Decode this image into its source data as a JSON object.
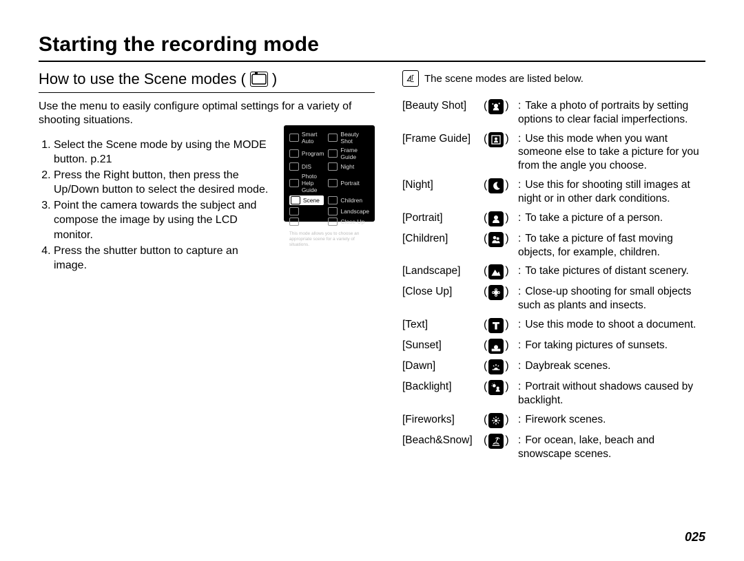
{
  "title": "Starting the recording mode",
  "page_number": "025",
  "left": {
    "subheading": "How to use the Scene modes (",
    "subheading_close": ")",
    "subheading_icon": "scene-mode-icon",
    "intro": "Use the menu to easily configure optimal settings for a variety of shooting situations.",
    "steps": [
      "Select the Scene mode by using the MODE button. p.21",
      "Press the Right button, then press the Up/Down button to select the desired mode.",
      "Point the camera towards the subject and compose the image by using the LCD monitor.",
      "Press the shutter button to capture an image."
    ],
    "lcd_menu_left": [
      "Smart Auto",
      "Program",
      "DIS",
      "Photo Help Guide",
      "Scene"
    ],
    "lcd_menu_right": [
      "Beauty Shot",
      "Frame Guide",
      "Night",
      "Portrait",
      "Children",
      "Landscape",
      "Close Up"
    ],
    "lcd_highlight": "Scene",
    "lcd_desc": "This mode allows you to choose an appropriate scene for a variety of situations."
  },
  "right": {
    "note": "The scene modes are listed below.",
    "modes": [
      {
        "label": "[Beauty Shot]",
        "icon": "beauty-shot-icon",
        "desc": "Take a photo of portraits by setting options to clear facial imperfections."
      },
      {
        "label": "[Frame Guide]",
        "icon": "frame-guide-icon",
        "desc": "Use this mode when you want someone else to take a picture for you from the angle you choose."
      },
      {
        "label": "[Night]",
        "icon": "night-icon",
        "desc": "Use this for shooting still images at night or in other dark conditions."
      },
      {
        "label": "[Portrait]",
        "icon": "portrait-icon",
        "desc": "To take a picture of a person."
      },
      {
        "label": "[Children]",
        "icon": "children-icon",
        "desc": "To take a picture of fast moving objects, for example, children."
      },
      {
        "label": "[Landscape]",
        "icon": "landscape-icon",
        "desc": "To take pictures of distant scenery."
      },
      {
        "label": "[Close Up]",
        "icon": "close-up-icon",
        "desc": "Close-up shooting for small objects such as plants and insects."
      },
      {
        "label": "[Text]",
        "icon": "text-icon",
        "desc": "Use this mode to shoot a document."
      },
      {
        "label": "[Sunset]",
        "icon": "sunset-icon",
        "desc": "For taking pictures of sunsets."
      },
      {
        "label": "[Dawn]",
        "icon": "dawn-icon",
        "desc": "Daybreak scenes."
      },
      {
        "label": "[Backlight]",
        "icon": "backlight-icon",
        "desc": "Portrait without shadows caused by backlight."
      },
      {
        "label": "[Fireworks]",
        "icon": "fireworks-icon",
        "desc": "Firework scenes."
      },
      {
        "label": "[Beach&Snow]",
        "icon": "beach-snow-icon",
        "desc": "For ocean, lake, beach and snowscape scenes."
      }
    ]
  }
}
